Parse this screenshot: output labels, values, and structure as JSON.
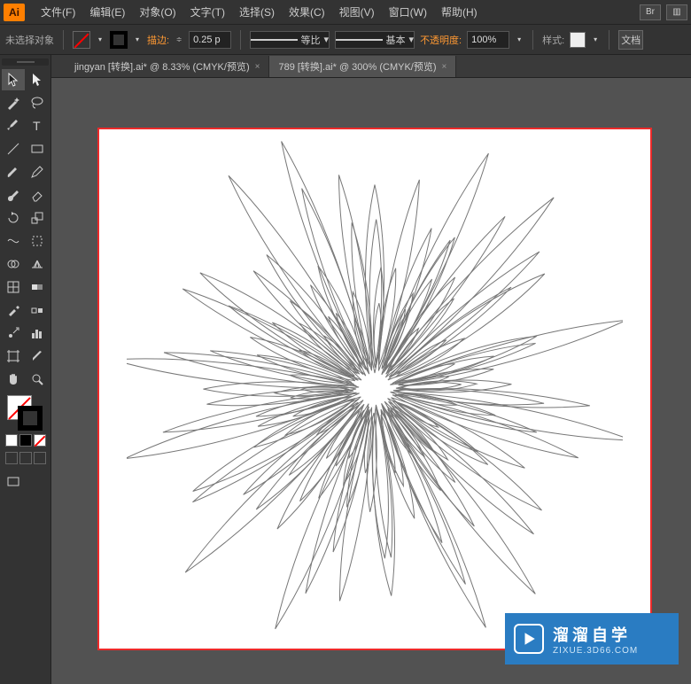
{
  "app": {
    "logo": "Ai"
  },
  "menu": {
    "items": [
      "文件(F)",
      "编辑(E)",
      "对象(O)",
      "文字(T)",
      "选择(S)",
      "效果(C)",
      "视图(V)",
      "窗口(W)",
      "帮助(H)"
    ],
    "right": {
      "br": "Br",
      "layout": "▥"
    }
  },
  "options": {
    "status": "未选择对象",
    "stroke_label": "描边:",
    "stroke_width": "0.25 p",
    "uniform_label": "等比",
    "basic_label": "基本",
    "opacity_label": "不透明度:",
    "opacity_value": "100%",
    "style_label": "样式:",
    "doc_setup": "文档"
  },
  "tabs": [
    {
      "label": "jingyan [转换].ai* @ 8.33% (CMYK/预览)",
      "active": false
    },
    {
      "label": "789 [转换].ai* @ 300% (CMYK/预览)",
      "active": true
    }
  ],
  "watermark": {
    "title": "溜溜自学",
    "url": "ZIXUE.3D66.COM"
  }
}
